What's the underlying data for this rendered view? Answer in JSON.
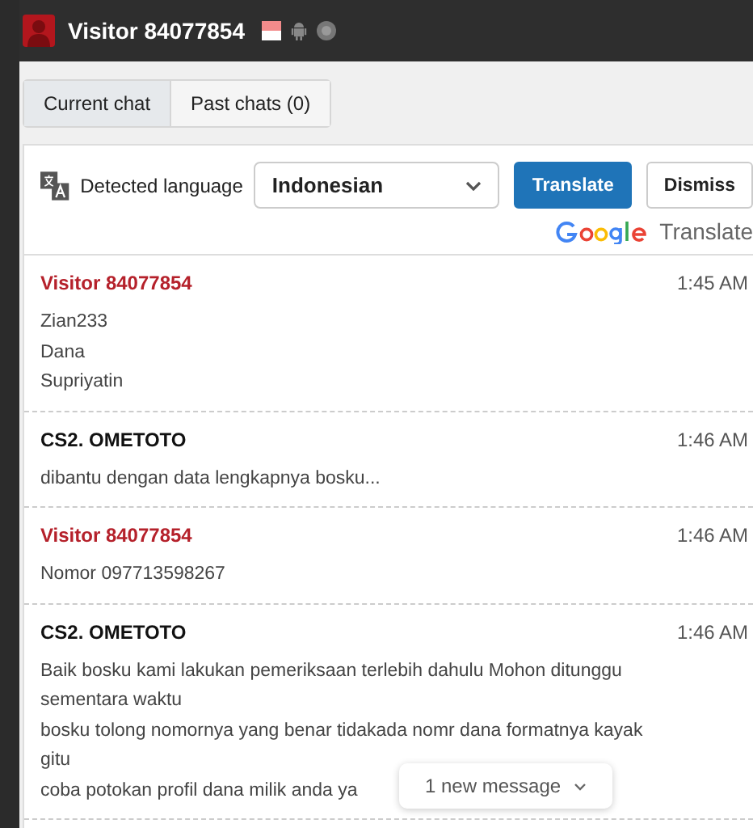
{
  "header": {
    "title": "Visitor 84077854"
  },
  "tabs": [
    {
      "label": "Current chat",
      "selected": true
    },
    {
      "label": "Past chats (0)",
      "selected": false
    }
  ],
  "translate_bar": {
    "label": "Detected language",
    "language": "Indonesian",
    "buttons": [
      "Translate",
      "Dismiss"
    ],
    "credit": "Translate"
  },
  "messages": [
    {
      "kind": "visitor",
      "author": "Visitor 84077854",
      "time": "1:45 AM",
      "lines": [
        "Zian233",
        "Dana",
        "Supriyatin"
      ]
    },
    {
      "kind": "agent",
      "author": "CS2. OMETOTO",
      "time": "1:46 AM",
      "lines": [
        "dibantu dengan data lengkapnya bosku..."
      ]
    },
    {
      "kind": "visitor",
      "author": "Visitor 84077854",
      "time": "1:46 AM",
      "lines": [
        "Nomor 097713598267"
      ]
    },
    {
      "kind": "agent",
      "author": "CS2. OMETOTO",
      "time": "1:46 AM",
      "lines": [
        "Baik bosku kami lakukan pemeriksaan terlebih dahulu Mohon ditunggu sementara waktu",
        "bosku tolong nomornya yang benar tidakada nomr dana formatnya kayak gitu",
        "coba potokan profil dana milik anda ya"
      ]
    }
  ],
  "new_message_pill": "1 new message"
}
